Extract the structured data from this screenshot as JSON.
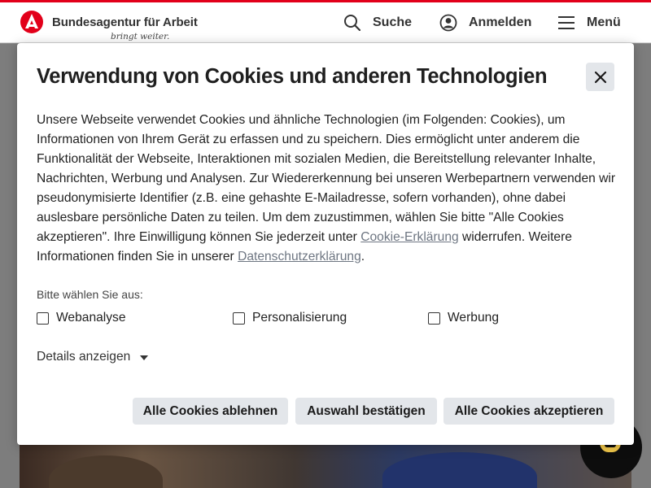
{
  "header": {
    "brand_name": "Bundesagentur für Arbeit",
    "brand_slogan": "bringt weiter.",
    "search_label": "Suche",
    "login_label": "Anmelden",
    "menu_label": "Menü"
  },
  "dialog": {
    "title": "Verwendung von Cookies und anderen Technologien",
    "text_part1": "Unsere Webseite verwendet Cookies und ähnliche Technologien (im Folgenden: Cookies), um Informationen von Ihrem Gerät zu erfassen und zu speichern. Dies ermöglicht unter anderem die Funktionalität der Webseite, Interaktionen mit sozialen Medien, die Bereitstellung relevanter Inhalte, Nachrichten, Werbung und Analysen. Zur Wiedererkennung bei unseren Werbepartnern verwenden wir pseudonymisierte Identifier (z.B. eine gehashte E-Mailadresse, sofern vorhanden), ohne dabei auslesbare persönliche Daten zu teilen. Um dem zuzustimmen, wählen Sie bitte \"Alle Cookies akzeptieren\". Ihre Einwilligung können Sie jederzeit unter ",
    "link_cookie": "Cookie-Erklärung",
    "text_part2": " widerrufen. Weitere Informationen finden Sie in unserer ",
    "link_privacy": "Datenschutzerklärung",
    "text_part3": ".",
    "choose_label": "Bitte wählen Sie aus:",
    "options": [
      {
        "label": "Webanalyse",
        "checked": false
      },
      {
        "label": "Personalisierung",
        "checked": false
      },
      {
        "label": "Werbung",
        "checked": false
      }
    ],
    "details_label": "Details anzeigen",
    "buttons": {
      "reject": "Alle Cookies ablehnen",
      "confirm": "Auswahl bestätigen",
      "accept": "Alle Cookies akzeptieren"
    }
  },
  "colors": {
    "brand_red": "#e2001a",
    "button_bg": "#e3e6ea",
    "link": "#6e7682",
    "chat_face": "#f2c84b"
  },
  "icons": [
    "search-icon",
    "user-icon",
    "menu-icon",
    "close-icon",
    "caret-down-icon",
    "chat-assistant-icon",
    "brand-logo-icon"
  ]
}
